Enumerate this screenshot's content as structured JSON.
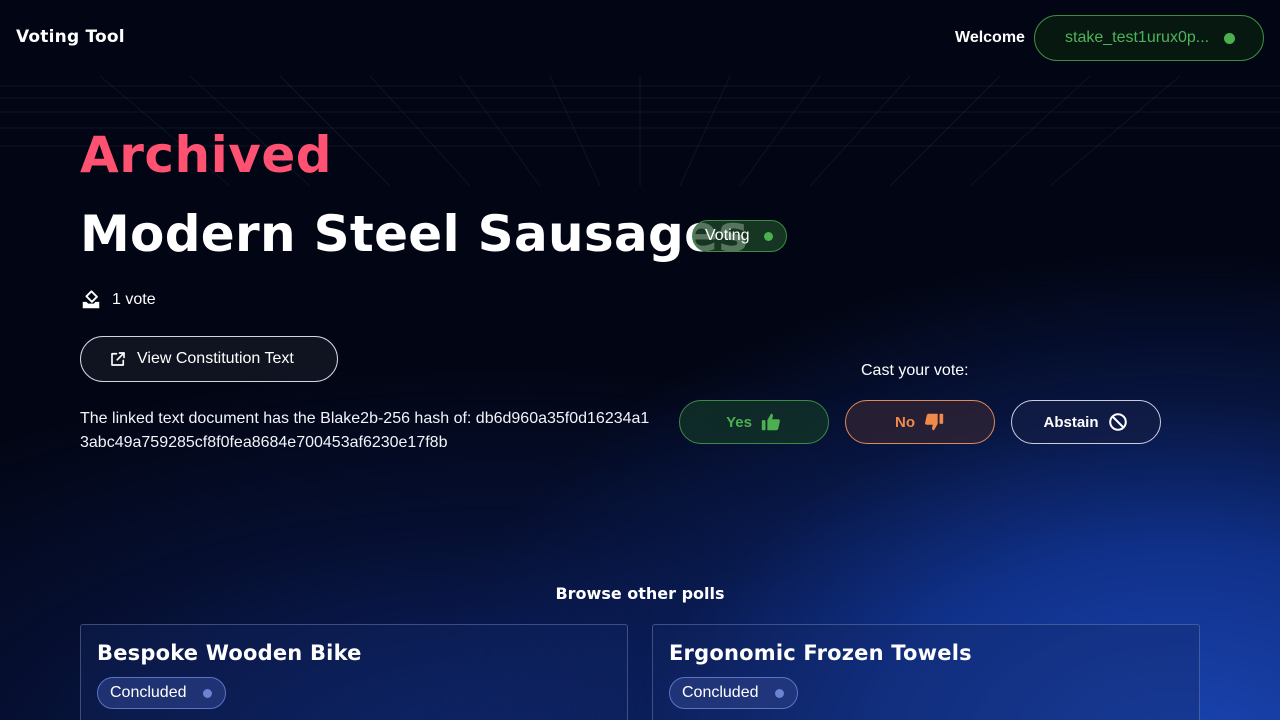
{
  "header": {
    "app_title": "Voting Tool",
    "welcome": "Welcome",
    "wallet_address": "stake_test1urux0p..."
  },
  "poll": {
    "archived_label": "Archived",
    "title": "Modern Steel Sausages",
    "status": "Voting",
    "vote_count": "1 vote",
    "constitution_button": "View Constitution Text",
    "hash_text": "The linked text document has the Blake2b-256 hash of: db6d960a35f0d16234a13abc49a759285cf8f0fea8684e700453af6230e17f8b"
  },
  "vote": {
    "cast_label": "Cast your vote:",
    "yes_label": "Yes",
    "no_label": "No",
    "abstain_label": "Abstain"
  },
  "browse": {
    "title": "Browse other polls",
    "polls": [
      {
        "title": "Bespoke Wooden Bike",
        "status": "Concluded"
      },
      {
        "title": "Ergonomic Frozen Towels",
        "status": "Concluded"
      }
    ]
  },
  "colors": {
    "archived": "#ff5273",
    "voting_green": "#4caf50",
    "no_orange": "#f08a4b",
    "concluded_blue": "#6b83d1"
  }
}
